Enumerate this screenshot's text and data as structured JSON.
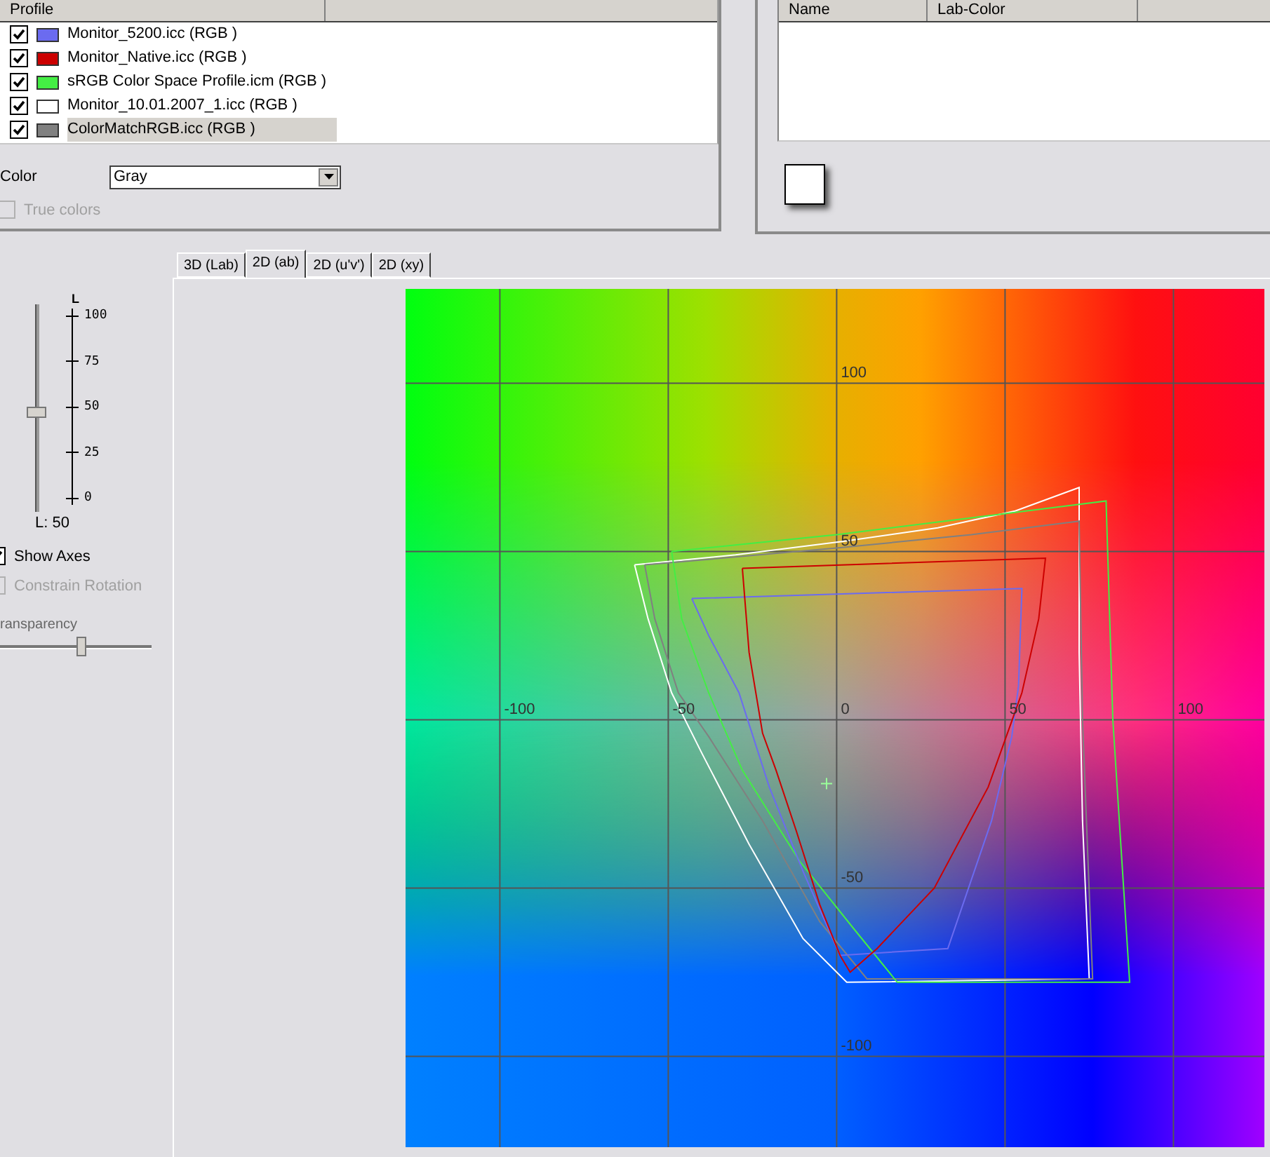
{
  "profiles": {
    "columns": [
      "Profile"
    ],
    "items": [
      {
        "name": "Monitor_5200.icc (RGB )",
        "checked": true,
        "selected": false,
        "color": "#6b6bf0"
      },
      {
        "name": "Monitor_Native.icc (RGB )",
        "checked": true,
        "selected": false,
        "color": "#cc0000"
      },
      {
        "name": "sRGB Color Space Profile.icm (RGB )",
        "checked": true,
        "selected": false,
        "color": "#44ee44"
      },
      {
        "name": "Monitor_10.01.2007_1.icc (RGB )",
        "checked": true,
        "selected": false,
        "color": "#ffffff"
      },
      {
        "name": "ColorMatchRGB.icc (RGB )",
        "checked": true,
        "selected": true,
        "color": "#808080"
      }
    ]
  },
  "color_select": {
    "label": "Color",
    "value": "Gray"
  },
  "true_colors": {
    "label": "True colors",
    "checked": false,
    "disabled": true
  },
  "swatch_table": {
    "columns": [
      "Name",
      "Lab-Color"
    ]
  },
  "lightness": {
    "axis_label": "L",
    "ticks": [
      "100",
      "75",
      "50",
      "25",
      "0"
    ],
    "level": 0.5,
    "reading": "L: 50"
  },
  "options": [
    {
      "label": "Show Axes",
      "checked": true,
      "disabled": false
    },
    {
      "label": "Constrain Rotation",
      "checked": false,
      "disabled": true
    }
  ],
  "transparency": {
    "label": "ransparency",
    "level": 0.55
  },
  "tabs": [
    {
      "label": "3D (Lab)",
      "selected": false
    },
    {
      "label": "2D (ab)",
      "selected": true
    },
    {
      "label": "2D (u'v')",
      "selected": false
    },
    {
      "label": "2D (xy)",
      "selected": false
    }
  ],
  "plot": {
    "a_axis_labels": [
      "-100",
      "-50",
      "0",
      "50",
      "100"
    ],
    "b_axis_labels": [
      "100",
      "50",
      "-50",
      "-100"
    ]
  }
}
